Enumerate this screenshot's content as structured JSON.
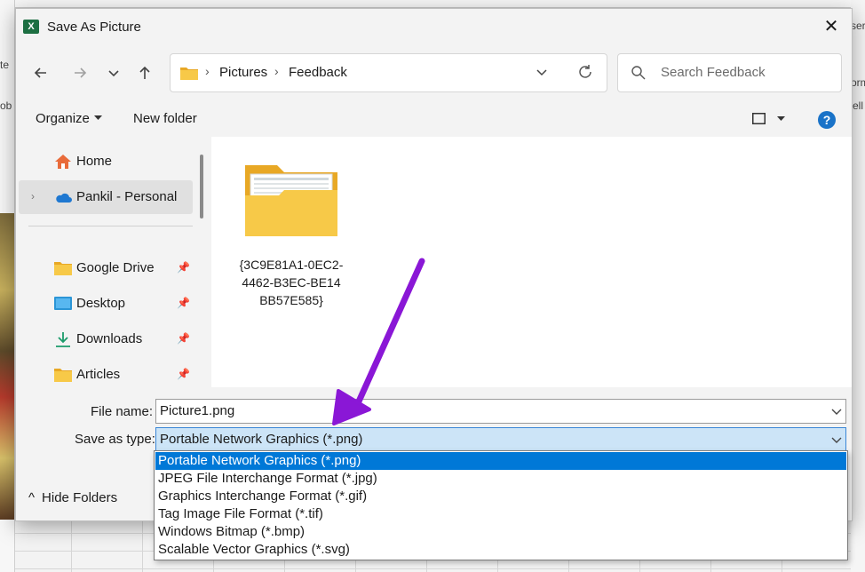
{
  "dialog": {
    "title": "Save As Picture",
    "app_icon_letter": "X",
    "close_glyph": "✕"
  },
  "nav": {
    "breadcrumbs": [
      "Pictures",
      "Feedback"
    ],
    "separator": "›",
    "search_placeholder": "Search Feedback"
  },
  "commandbar": {
    "organize": "Organize",
    "new_folder": "New folder",
    "help": "?"
  },
  "sidebar": {
    "items": [
      {
        "label": "Home",
        "icon": "home-icon"
      },
      {
        "label": "Pankil - Personal",
        "icon": "onedrive-cloud-icon",
        "selected": true,
        "expander": "›"
      },
      {
        "label": "Google Drive",
        "icon": "folder-icon",
        "pinned": true
      },
      {
        "label": "Desktop",
        "icon": "desktop-icon",
        "pinned": true
      },
      {
        "label": "Downloads",
        "icon": "download-icon",
        "pinned": true
      },
      {
        "label": "Articles",
        "icon": "folder-icon",
        "pinned": true
      }
    ],
    "pin_glyph": "📌"
  },
  "content": {
    "items": [
      {
        "name": "{3C9E81A1-0EC2-4462-B3EC-BE14BB57E585}",
        "type": "folder"
      }
    ]
  },
  "form": {
    "file_name_label": "File name:",
    "file_name_value": "Picture1.png",
    "save_type_label": "Save as type:",
    "save_type_value": "Portable Network Graphics (*.png)",
    "type_options": [
      "Portable Network Graphics (*.png)",
      "JPEG File Interchange Format (*.jpg)",
      "Graphics Interchange Format (*.gif)",
      "Tag Image File Format (*.tif)",
      "Windows Bitmap (*.bmp)",
      "Scalable Vector Graphics (*.svg)"
    ],
    "selected_option_index": 0,
    "hide_folders": "Hide Folders",
    "hide_folders_glyph": "^"
  },
  "background": {
    "fragments": [
      "te",
      "ob",
      "ser",
      "orm",
      "ell"
    ]
  },
  "colors": {
    "accent": "#0078d7",
    "arrow": "#8a17d6",
    "folder": "#f7c948",
    "excel": "#1d6f42"
  }
}
